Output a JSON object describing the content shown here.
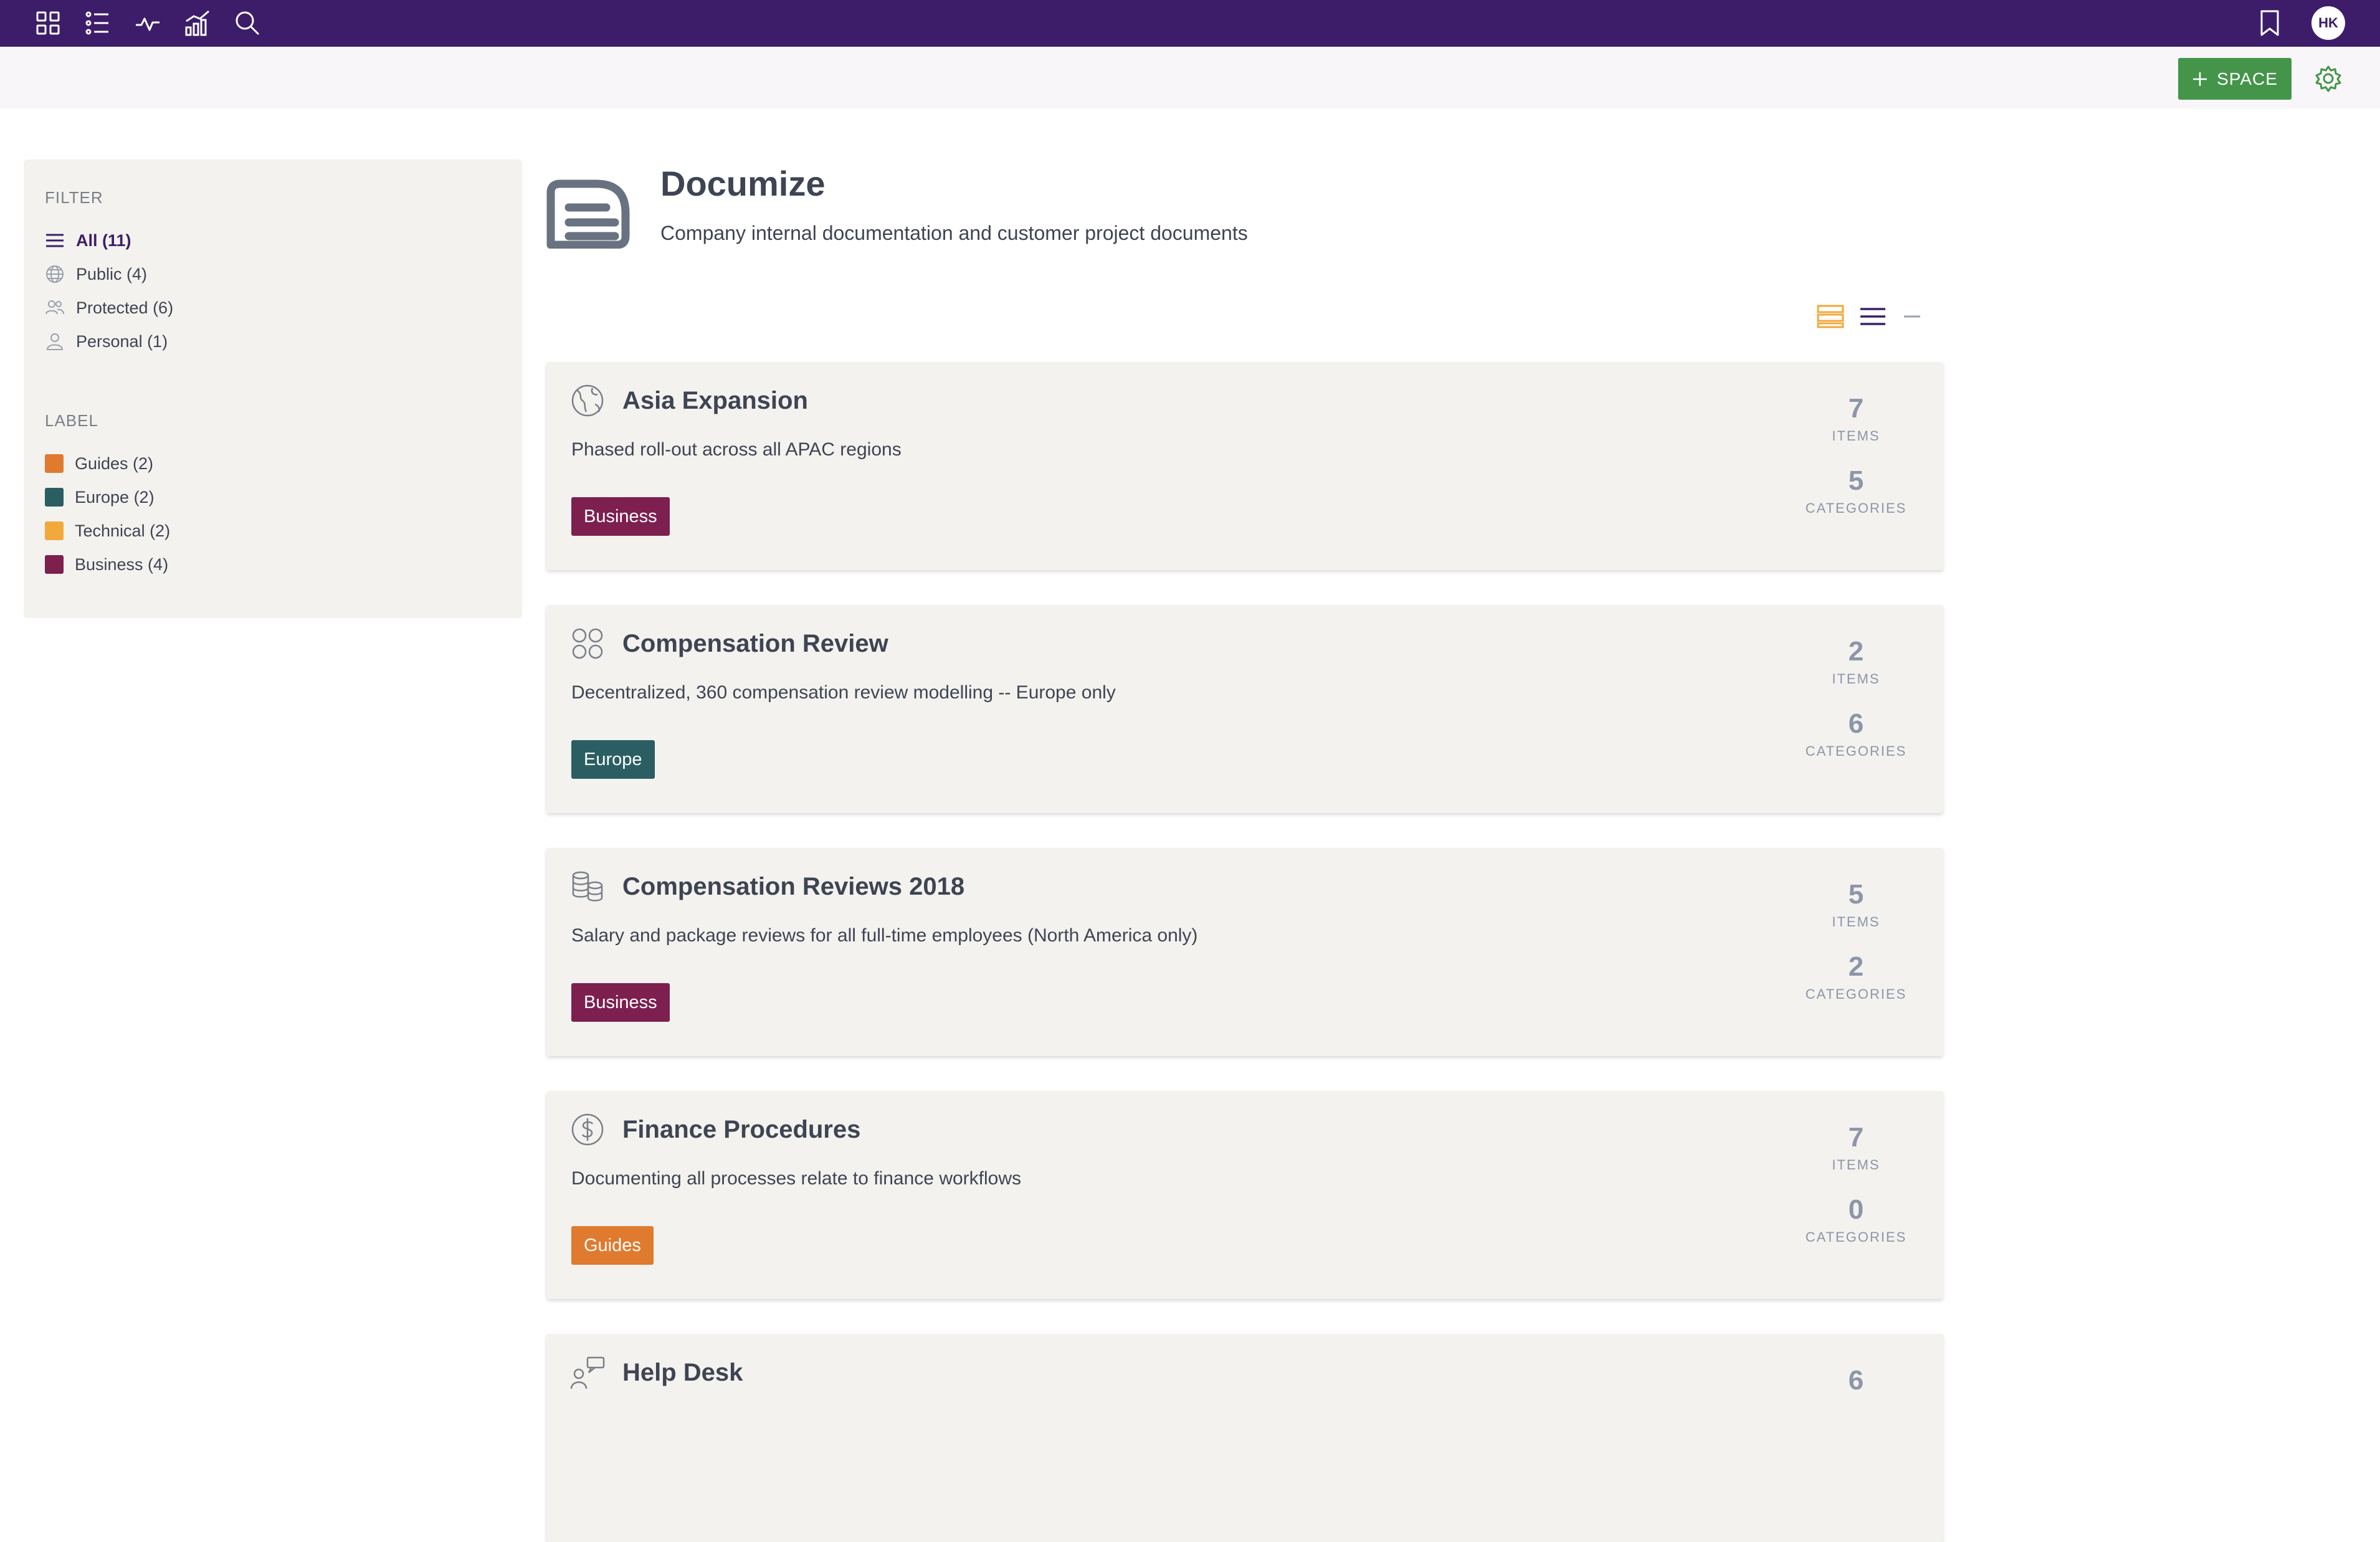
{
  "topnav": {
    "icons": [
      "grid-icon",
      "list-icon",
      "activity-icon",
      "analytics-icon",
      "search-icon",
      "bookmark-icon"
    ],
    "avatar_initials": "HK",
    "color": "#3d1d6a"
  },
  "toolbar": {
    "add_space_label": "SPACE",
    "button_color": "#44954a"
  },
  "sidebar": {
    "filter_heading": "FILTER",
    "filters": [
      {
        "label": "All (11)",
        "icon": "list-icon"
      },
      {
        "label": "Public (4)",
        "icon": "globe-icon"
      },
      {
        "label": "Protected (6)",
        "icon": "users-icon"
      },
      {
        "label": "Personal (1)",
        "icon": "user-icon"
      }
    ],
    "label_heading": "LABEL",
    "labels": [
      {
        "label": "Guides (2)",
        "color": "#e07a2e"
      },
      {
        "label": "Europe (2)",
        "color": "#2a5e62"
      },
      {
        "label": "Technical (2)",
        "color": "#f2a93b"
      },
      {
        "label": "Business (4)",
        "color": "#7d1f4f"
      }
    ]
  },
  "header": {
    "title": "Documize",
    "description": "Company internal documentation and customer project documents"
  },
  "spaces": [
    {
      "title": "Asia Expansion",
      "description": "Phased roll-out across all APAC regions",
      "tag": "Business",
      "tag_color": "#7d1f4f",
      "items": "7",
      "categories": "5",
      "icon": "globe-icon"
    },
    {
      "title": "Compensation Review",
      "description": "Decentralized, 360 compensation review modelling -- Europe only",
      "tag": "Europe",
      "tag_color": "#2a5e62",
      "items": "2",
      "categories": "6",
      "icon": "circles-icon"
    },
    {
      "title": "Compensation Reviews 2018",
      "description": "Salary and package reviews for all full-time employees (North America only)",
      "tag": "Business",
      "tag_color": "#7d1f4f",
      "items": "5",
      "categories": "2",
      "icon": "coins-icon"
    },
    {
      "title": "Finance Procedures",
      "description": "Documenting all processes relate to finance workflows",
      "tag": "Guides",
      "tag_color": "#e07a2e",
      "items": "7",
      "categories": "0",
      "icon": "dollar-icon"
    },
    {
      "title": "Help Desk",
      "description": "",
      "tag": "",
      "tag_color": "",
      "items": "6",
      "categories": "",
      "icon": "help-desk-icon"
    }
  ],
  "stat_labels": {
    "items": "ITEMS",
    "categories": "CATEGORIES"
  }
}
